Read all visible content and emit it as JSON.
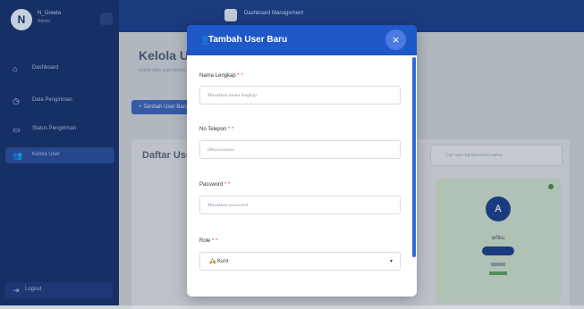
{
  "sidebar": {
    "avatar_initial": "N",
    "user_name": "N_Greeta",
    "user_role": "Admin",
    "items": [
      {
        "label": "Dashboard",
        "icon": "home-icon"
      },
      {
        "label": "Data Pengiriman",
        "icon": "clock-icon"
      },
      {
        "label": "Status Pengiriman",
        "icon": "truck-icon"
      },
      {
        "label": "Kelola User",
        "icon": "users-icon"
      }
    ],
    "logout_label": "Logout"
  },
  "topbar": {
    "title": "Dashboard Management"
  },
  "page": {
    "title": "Kelola User",
    "subtitle": "Kelola data user sistem",
    "add_button": "+ Tambah User Baru"
  },
  "user_list": {
    "title": "Daftar User",
    "search_placeholder": "Cari user berdasarkan nama..."
  },
  "user_card": {
    "initial": "A",
    "name": "arfiku"
  },
  "modal": {
    "title": "Tambah User Baru",
    "close": "×",
    "fields": [
      {
        "label": "Nama Lengkap",
        "required": "*",
        "placeholder": "Masukkan nama lengkap"
      },
      {
        "label": "No Telepon",
        "required": "*",
        "placeholder": "08xxxxxxxxxx"
      },
      {
        "label": "Password",
        "required": "*",
        "placeholder": "Masukkan password"
      }
    ],
    "role": {
      "label": "Role",
      "required": "*",
      "selected": "Kurir",
      "caret": "▾"
    }
  },
  "colors": {
    "sidebar": "#17316d",
    "modal_header": "#1f58c9",
    "required": "#dc3545"
  }
}
